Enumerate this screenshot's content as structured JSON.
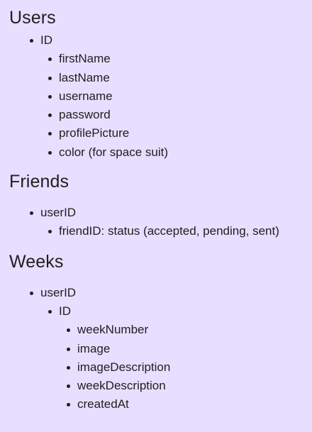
{
  "sections": [
    {
      "heading": "Users",
      "items": [
        {
          "label": "ID",
          "children": [
            {
              "label": "firstName"
            },
            {
              "label": "lastName"
            },
            {
              "label": "username"
            },
            {
              "label": "password"
            },
            {
              "label": "profilePicture"
            },
            {
              "label": "color (for space suit)"
            }
          ]
        }
      ]
    },
    {
      "heading": "Friends",
      "items": [
        {
          "label": "userID",
          "children": [
            {
              "label": "friendID: status (accepted, pending, sent)"
            }
          ]
        }
      ]
    },
    {
      "heading": "Weeks",
      "items": [
        {
          "label": "userID",
          "children": [
            {
              "label": "ID",
              "children": [
                {
                  "label": "weekNumber"
                },
                {
                  "label": "image"
                },
                {
                  "label": "imageDescription"
                },
                {
                  "label": "weekDescription"
                },
                {
                  "label": "createdAt"
                }
              ]
            }
          ]
        }
      ]
    }
  ],
  "colors": {
    "background": "#e8deff",
    "text": "#1f1f1f"
  }
}
